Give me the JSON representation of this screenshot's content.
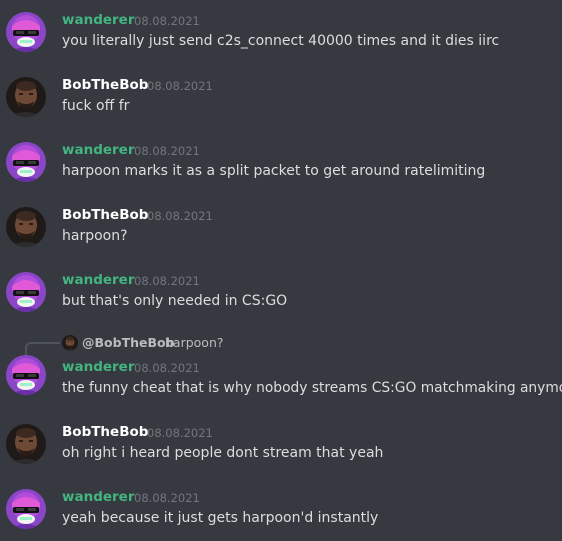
{
  "colors": {
    "background": "#36393f",
    "wanderer_name": "#43b581",
    "bob_name": "#ffffff",
    "timestamp": "#72767d",
    "message_text": "#dcddde"
  },
  "messages": [
    {
      "author": "wanderer",
      "time": "08.08.2021",
      "text": "you literally just send c2s_connect 40000 times and it dies iirc"
    },
    {
      "author": "BobTheBob",
      "time": "08.08.2021",
      "text": "fuck off fr"
    },
    {
      "author": "wanderer",
      "time": "08.08.2021",
      "text": "harpoon marks it as a split packet to get around ratelimiting"
    },
    {
      "author": "BobTheBob",
      "time": "08.08.2021",
      "text": "harpoon?"
    },
    {
      "author": "wanderer",
      "time": "08.08.2021",
      "text": "but that's only needed in CS:GO"
    },
    {
      "author": "wanderer",
      "time": "08.08.2021",
      "text": "the funny cheat that is why nobody streams CS:GO matchmaking anymore",
      "reply": {
        "author": "@BobTheBob",
        "text": "harpoon?"
      }
    },
    {
      "author": "BobTheBob",
      "time": "08.08.2021",
      "text": "oh right i heard people dont stream that yeah"
    },
    {
      "author": "wanderer",
      "time": "08.08.2021",
      "text": "yeah because it just gets harpoon'd instantly"
    }
  ]
}
